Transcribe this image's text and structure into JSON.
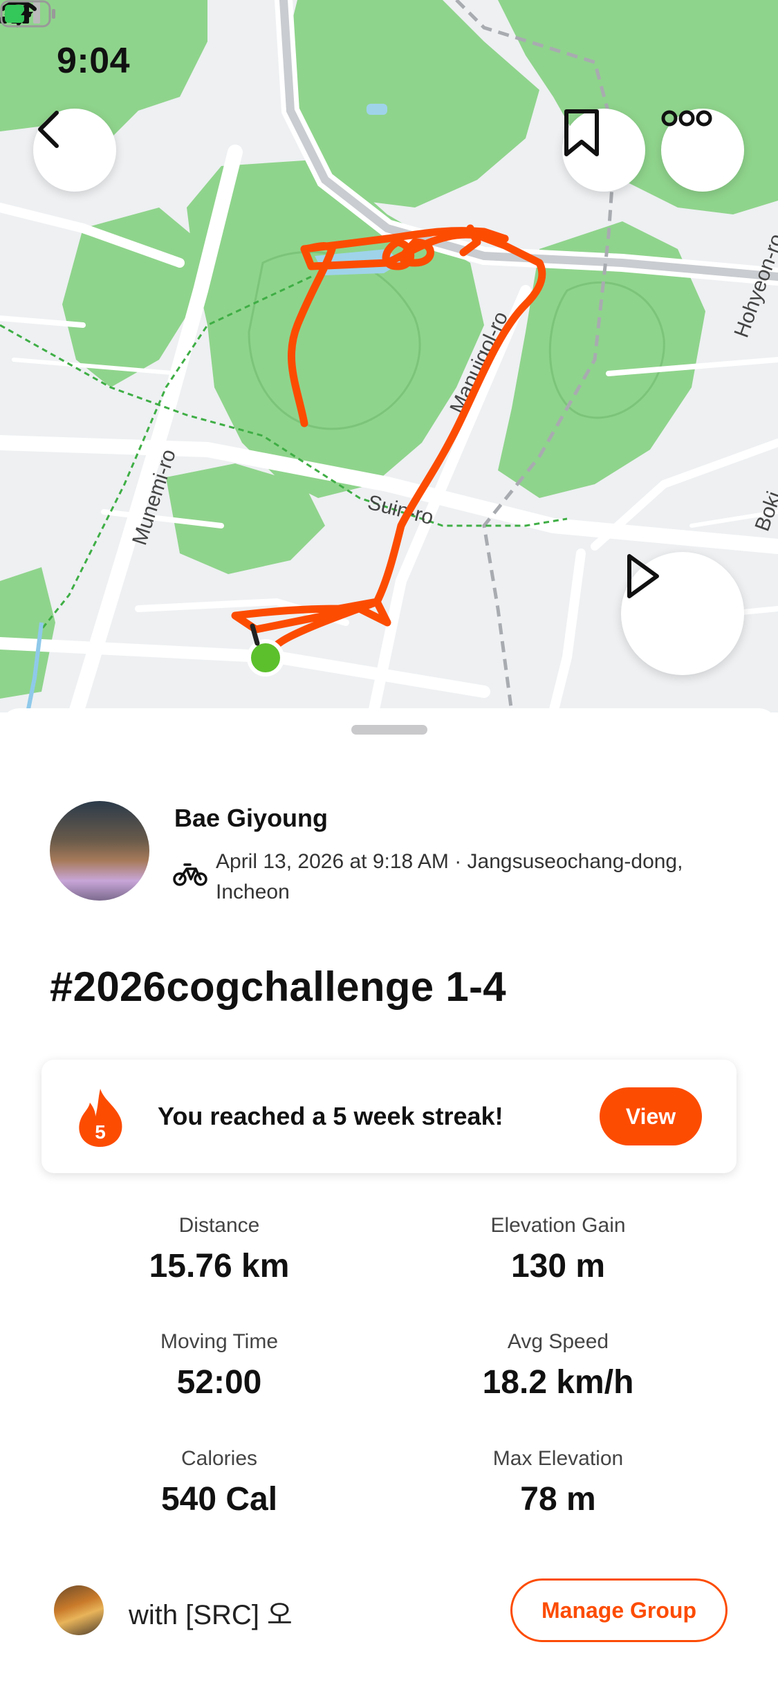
{
  "status_bar": {
    "time": "9:04"
  },
  "map": {
    "street_labels": [
      "Munemi-ro",
      "Suin-ro",
      "Manuigol-ro",
      "Hohyeon-ro",
      "Boki"
    ],
    "route_color": "#fc4c02",
    "start_marker_color": "#5cc02c"
  },
  "activity": {
    "athlete_name": "Bae Giyoung",
    "meta": "April 13, 2026 at 9:18 AM · Jangsuseochang-dong, Incheon",
    "title": "#2026cogchallenge 1-4"
  },
  "streak": {
    "count": "5",
    "text": "You reached a 5 week streak!",
    "button": "View"
  },
  "stats": [
    {
      "label": "Distance",
      "value": "15.76 km"
    },
    {
      "label": "Elevation Gain",
      "value": "130 m"
    },
    {
      "label": "Moving Time",
      "value": "52:00"
    },
    {
      "label": "Avg Speed",
      "value": "18.2 km/h"
    },
    {
      "label": "Calories",
      "value": "540 Cal"
    },
    {
      "label": "Max Elevation",
      "value": "78 m"
    }
  ],
  "group": {
    "with_text": "with [SRC] 오",
    "manage_button": "Manage Group"
  },
  "colors": {
    "accent": "#fc4c02",
    "park": "#8fd48c",
    "water": "#9fd3ea"
  }
}
